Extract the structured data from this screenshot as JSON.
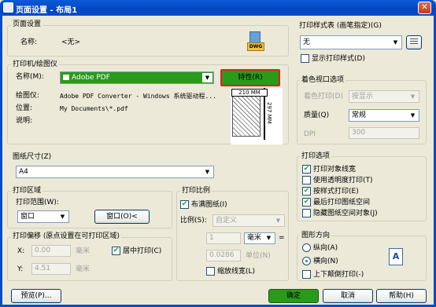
{
  "window": {
    "title": "页面设置 - 布局1",
    "close": "✕"
  },
  "page_setup": {
    "group": "页面设置",
    "name_label": "名称:",
    "name_value": "<无>",
    "dwg_label": "DWG"
  },
  "printer": {
    "group": "打印机/绘图仪",
    "name_label": "名称(M):",
    "name_value": "Adobe PDF",
    "properties": "特性(R)",
    "plotter_label": "绘图仪:",
    "plotter_value": "Adobe PDF Converter - Windows 系统驱动程...",
    "where_label": "位置:",
    "where_value": "My Documents\\*.pdf",
    "desc_label": "说明:",
    "width_dim": "210 MM",
    "height_dim": "297 MM"
  },
  "paper_size": {
    "group": "图纸尺寸(Z)",
    "value": "A4"
  },
  "print_area": {
    "group": "打印区域",
    "range_label": "打印范围(W):",
    "range_value": "窗口",
    "window_btn": "窗口(O)<"
  },
  "offset": {
    "group": "打印偏移 (原点设置在可打印区域)",
    "x_label": "X:",
    "x_value": "0.00",
    "x_unit": "毫米",
    "y_label": "Y:",
    "y_value": "4.51",
    "y_unit": "毫米",
    "center": "居中打印(C)"
  },
  "scale": {
    "group": "打印比例",
    "fit": "布满图纸(I)",
    "scale_label": "比例(S):",
    "scale_value": "自定义",
    "value1": "1",
    "unit": "毫米",
    "value2": "0.0286",
    "unit2": "单位(N)",
    "lineweights": "缩放线宽(L)"
  },
  "style_table": {
    "group": "打印样式表 (画笔指定)(G)",
    "value": "无",
    "display": "显示打印样式(D)"
  },
  "shaded": {
    "group": "着色视口选项",
    "shade_label": "着色打印(D)",
    "shade_value": "按显示",
    "quality_label": "质量(Q)",
    "quality_value": "常规",
    "dpi_label": "DPI",
    "dpi_value": "300"
  },
  "options": {
    "group": "打印选项",
    "items": [
      {
        "label": "打印对象线宽",
        "checked": true
      },
      {
        "label": "使用透明度打印(T)",
        "checked": false
      },
      {
        "label": "按样式打印(E)",
        "checked": true
      },
      {
        "label": "最后打印图纸空间",
        "checked": true
      },
      {
        "label": "隐藏图纸空间对象(J)",
        "checked": false
      }
    ]
  },
  "orientation": {
    "group": "图形方向",
    "portrait": "纵向(A)",
    "landscape": "横向(N)",
    "upside": "上下颠倒打印(-)",
    "icon_letter": "A"
  },
  "footer": {
    "preview": "预览(P)...",
    "ok": "确定",
    "cancel": "取消",
    "help": "帮助(H)"
  }
}
